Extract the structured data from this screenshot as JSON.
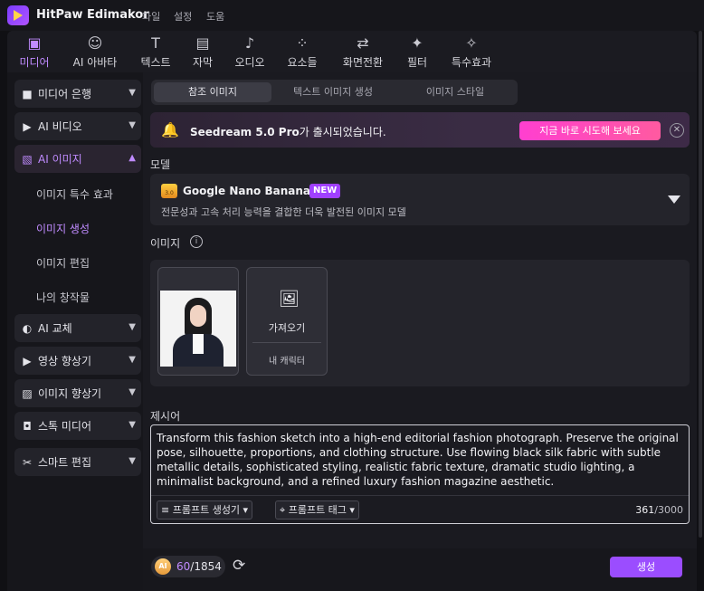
{
  "app": {
    "title": "HitPaw Edimakor",
    "menu": [
      "파일",
      "설정",
      "도움"
    ]
  },
  "toolbar": {
    "items": [
      {
        "label": "미디어",
        "icon": "media-icon",
        "active": true
      },
      {
        "label": "AI 아바타",
        "icon": "avatar-icon"
      },
      {
        "label": "텍스트",
        "icon": "text-icon"
      },
      {
        "label": "자막",
        "icon": "subtitle-icon"
      },
      {
        "label": "오디오",
        "icon": "audio-icon"
      },
      {
        "label": "요소들",
        "icon": "elements-icon"
      },
      {
        "label": "화면전환",
        "icon": "transition-icon"
      },
      {
        "label": "필터",
        "icon": "filter-icon"
      },
      {
        "label": "특수효과",
        "icon": "effects-icon"
      }
    ]
  },
  "sidebar": {
    "items": [
      {
        "label": "미디어 은행",
        "icon": "folder-icon"
      },
      {
        "label": "AI 비디오",
        "icon": "ai-video-icon"
      },
      {
        "label": "AI 이미지",
        "icon": "ai-image-icon",
        "active": true
      },
      {
        "label": "AI 교체",
        "icon": "swap-icon"
      },
      {
        "label": "영상 향상기",
        "icon": "video-enhance-icon"
      },
      {
        "label": "이미지 향상기",
        "icon": "image-enhance-icon"
      },
      {
        "label": "스톡 미디어",
        "icon": "stock-icon"
      },
      {
        "label": "스마트 편집",
        "icon": "smart-edit-icon"
      }
    ],
    "sub_items": [
      "이미지 특수 효과",
      "이미지 생성",
      "이미지 편집",
      "나의 창작물"
    ],
    "active_sub": "이미지 생성"
  },
  "tabs": [
    "참조 이미지",
    "텍스트 이미지 생성",
    "이미지 스타일"
  ],
  "banner": {
    "model_name": "Seedream 5.0 Pro",
    "message": "가 출시되었습니다.",
    "cta": "지금 바로 시도해 보세요",
    "close": "✕"
  },
  "model": {
    "section_label": "모델",
    "icon_text": "3.0",
    "name": "Google Nano Banana2",
    "badge": "NEW",
    "description": "전문성과 고속 처리 능력을 결합한 더욱 발전된 이미지 모델"
  },
  "image_section": {
    "label": "이미지",
    "info": "i",
    "import_label": "가져오기",
    "my_character": "내 캐릭터"
  },
  "prompt": {
    "label": "제시어",
    "text": "Transform this fashion sketch into a high-end editorial fashion photograph. Preserve the original pose, silhouette, proportions, and clothing structure. Use flowing black silk fabric with subtle metallic details, sophisticated styling, realistic fabric texture, dramatic studio lighting, a minimalist background, and a refined luxury fashion magazine aesthetic.",
    "generator": "프롬프트 생성기",
    "tags": "프롬프트 태그",
    "count": "361",
    "max": "/3000"
  },
  "footer": {
    "coin": "AI",
    "credits_current": "60",
    "credits_total": "/1854",
    "generate": "생성"
  },
  "colors": {
    "accent": "#9b4dff",
    "accent_text": "#c08bff",
    "banner_cta": "#ff3fd0"
  }
}
